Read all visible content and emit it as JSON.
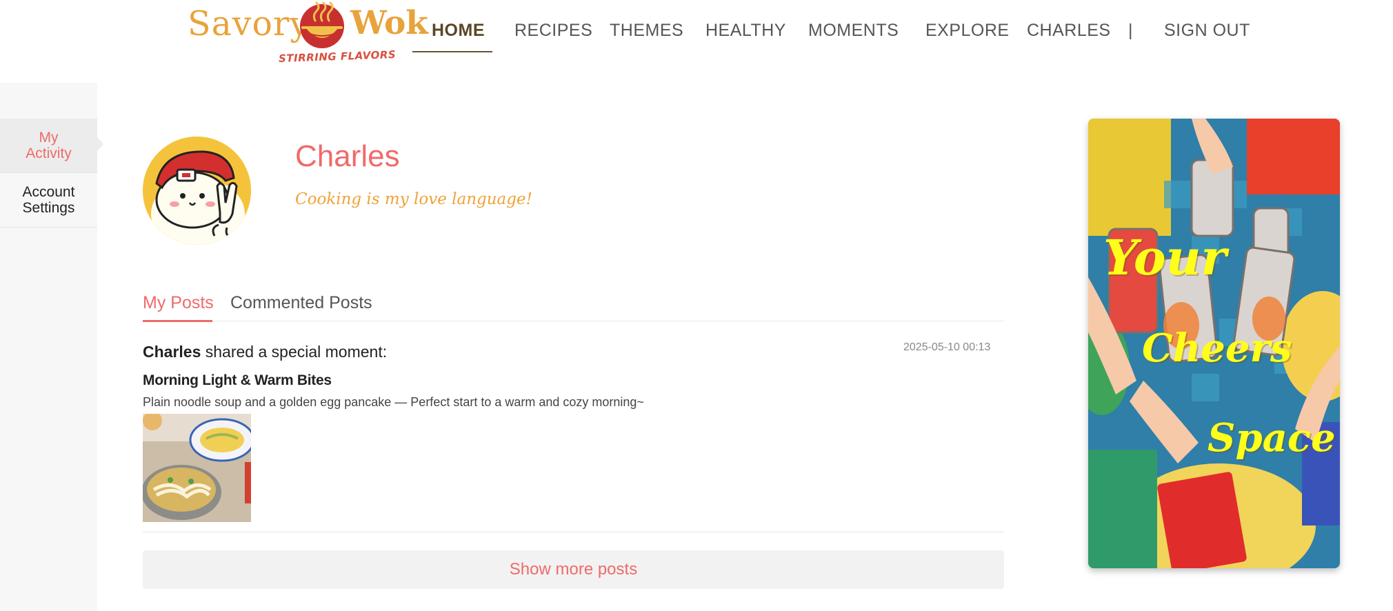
{
  "brand": {
    "name_left": "Savory",
    "name_right": "Wok",
    "tagline": "STIRRING FLAVORS",
    "color_primary": "#e8a33b",
    "color_accent": "#d8503f"
  },
  "nav": {
    "items": [
      {
        "label": "HOME",
        "active": true
      },
      {
        "label": "RECIPES"
      },
      {
        "label": "THEMES"
      },
      {
        "label": "HEALTHY"
      },
      {
        "label": "MOMENTS"
      },
      {
        "label": "EXPLORE"
      },
      {
        "label": "CHARLES"
      },
      {
        "label": "|"
      },
      {
        "label": "SIGN OUT"
      }
    ]
  },
  "sidebar": {
    "items": [
      {
        "label": "My Activity",
        "active": true
      },
      {
        "label": "Account Settings",
        "active": false
      }
    ]
  },
  "profile": {
    "name": "Charles",
    "bio": "Cooking is my love language!",
    "name_color": "#f06a6a",
    "bio_color": "#eea338"
  },
  "tabs": [
    {
      "label": "My Posts",
      "active": true
    },
    {
      "label": "Commented Posts",
      "active": false
    }
  ],
  "posts": [
    {
      "author": "Charles",
      "action": " shared a special moment:",
      "timestamp": "2025-05-10 00:13",
      "title": "Morning Light & Warm Bites",
      "description": "Plain noodle soup and a golden egg pancake — Perfect start to a warm and cozy morning~"
    }
  ],
  "show_more_label": "Show more posts",
  "banner": {
    "words": [
      "Your",
      "Cheers",
      "Space"
    ],
    "text_color": "#ffff1a"
  },
  "icons": {
    "logo": "wok-bowl-icon",
    "avatar": "cartoon-dog-cap-avatar"
  }
}
